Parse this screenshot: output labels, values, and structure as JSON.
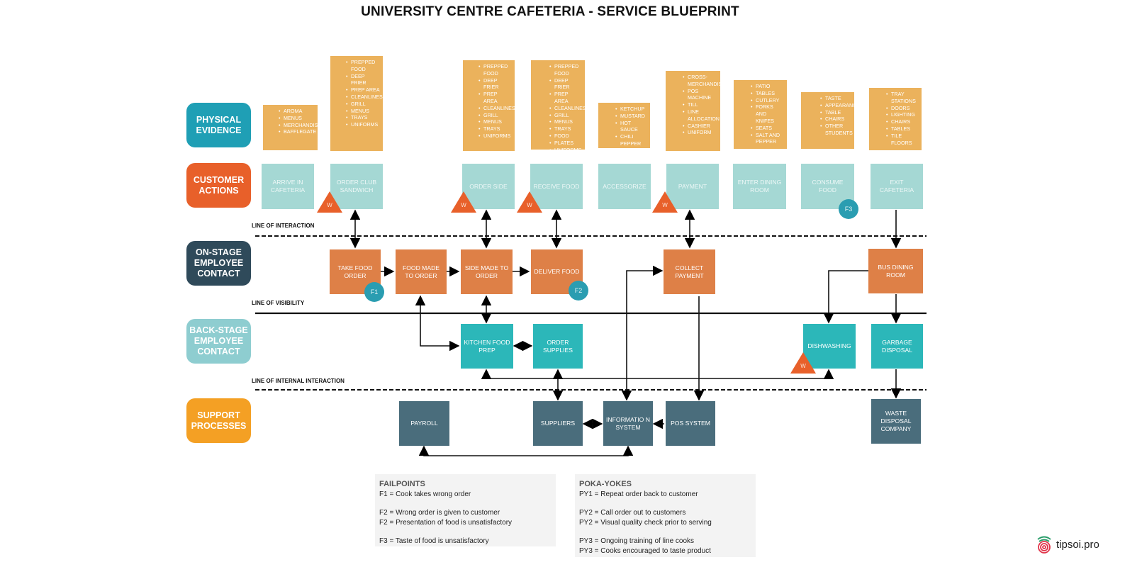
{
  "title": "UNIVERSITY CENTRE CAFETERIA - SERVICE BLUEPRINT",
  "colors": {
    "physical_evidence": "#1f9fb5",
    "customer_actions": "#e8602a",
    "onstage": "#2f4a5a",
    "backstage": "#8ecdd0",
    "support": "#f4a024",
    "evidence_box": "#ebb25c",
    "customer_box": "#a5d8d4",
    "onstage_box": "#de8047",
    "backstage_box": "#2cb7b9",
    "support_box": "#4a6d7c",
    "failpoint": "#2a9db1",
    "wait": "#e8602a"
  },
  "lanes": {
    "physical_evidence": "PHYSICAL EVIDENCE",
    "customer_actions": "CUSTOMER ACTIONS",
    "onstage": "ON-STAGE EMPLOYEE CONTACT",
    "backstage": "BACK-STAGE EMPLOYEE CONTACT",
    "support": "SUPPORT PROCESSES"
  },
  "lines": {
    "interaction": "LINE OF INTERACTION",
    "visibility": "LINE OF VISIBILITY",
    "internal": "LINE OF INTERNAL INTERACTION"
  },
  "evidence": [
    {
      "items": [
        "AROMA",
        "MENUS",
        "MERCHANDISE",
        "BAFFLEGATE"
      ]
    },
    {
      "items": [
        "PREPPED FOOD",
        "DEEP FRIER",
        "PREP AREA",
        "CLEANLINESS",
        "GRILL",
        "MENUS",
        "TRAYS",
        "UNIFORMS"
      ]
    },
    {
      "items": [
        "PREPPED FOOD",
        "DEEP FRIER",
        "PREP AREA",
        "CLEANLINESS",
        "GRILL",
        "MENUS",
        "TRAYS",
        "UNIFORMS"
      ]
    },
    {
      "items": [
        "PREPPED FOOD",
        "DEEP FRIER",
        "PREP AREA",
        "CLEANLINESS",
        "GRILL",
        "MENUS",
        "TRAYS",
        "FOOD",
        "PLATES",
        "UNIFORMS"
      ]
    },
    {
      "items": [
        "KETCHUP",
        "MUSTARD",
        "HOT SAUCE",
        "CHILI PEPPER"
      ]
    },
    {
      "items": [
        "CROSS-MERCHANDISE",
        "POS MACHINE",
        "TILL",
        "LINE ALLOCATION",
        "CASHIER",
        "UNIFORM"
      ]
    },
    {
      "items": [
        "PATIO",
        "TABLES",
        "CUTLERY",
        "FORKS AND KNIFES",
        "SEATS",
        "SALT AND PEPPER"
      ]
    },
    {
      "items": [
        "TASTE",
        "APPEARANCE",
        "TABLE",
        "CHAIRS",
        "OTHER STUDENTS"
      ]
    },
    {
      "items": [
        "TRAY STATIONS",
        "DOORS",
        "LIGHTING",
        "CHAIRS",
        "TABLES",
        "TILE FLOORS"
      ]
    }
  ],
  "customer_actions": [
    "ARRIVE IN CAFETERIA",
    "ORDER CLUB SANDWICH",
    "ORDER SIDE",
    "RECEIVE FOOD",
    "ACCESSORIZE",
    "PAYMENT",
    "ENTER DINING ROOM",
    "CONSUME FOOD",
    "EXIT CAFETERIA"
  ],
  "onstage": [
    "TAKE FOOD ORDER",
    "FOOD MADE TO ORDER",
    "SIDE MADE TO ORDER",
    "DELIVER FOOD",
    "COLLECT PAYMENT",
    "BUS DINING ROOM"
  ],
  "backstage": [
    "KITCHEN FOOD PREP",
    "ORDER SUPPLIES",
    "DISHWASHING",
    "GARBAGE DISPOSAL"
  ],
  "support": [
    "PAYROLL",
    "SUPPLIERS",
    "INFORMATIO N SYSTEM",
    "POS SYSTEM",
    "WASTE DISPOSAL COMPANY"
  ],
  "markers": {
    "wait": "W",
    "f1": "F1",
    "f2": "F2",
    "f3": "F3"
  },
  "failpoints": {
    "title": "FAILPOINTS",
    "items": [
      "F1 = Cook takes wrong order",
      "F2 = Wrong order is given to customer",
      "F2 = Presentation of food is unsatisfactory",
      "F3 = Taste of food is unsatisfactory"
    ]
  },
  "pokayokes": {
    "title": "POKA-YOKES",
    "items": [
      "PY1 = Repeat order back to customer",
      "PY2 = Call order out to customers",
      "PY2 = Visual quality check prior to serving",
      "PY3 = Ongoing training of line cooks",
      "PY3 = Cooks encouraged to taste product"
    ]
  },
  "brand": "tipsoi.pro"
}
